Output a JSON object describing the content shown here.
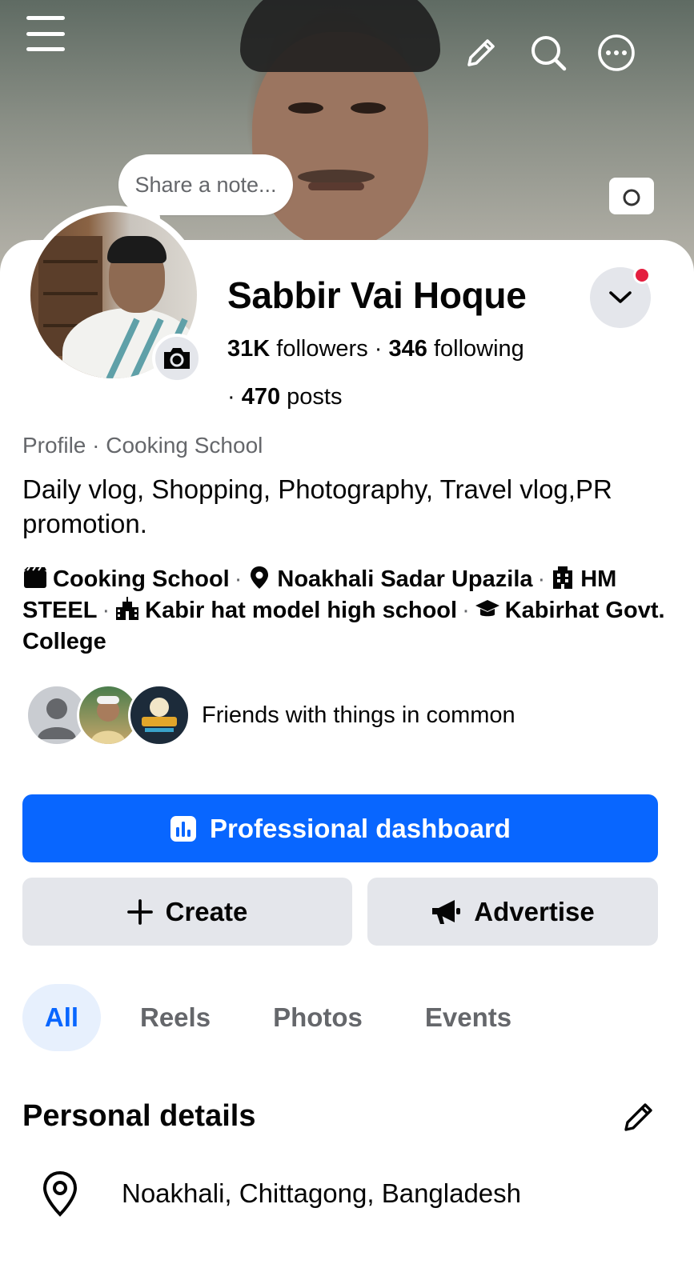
{
  "header": {
    "menu_icon": "hamburger-menu-icon",
    "edit_icon": "pencil-icon",
    "search_icon": "search-icon",
    "more_icon": "more-options-icon",
    "cover_camera_icon": "camera-icon"
  },
  "note": {
    "placeholder": "Share a note..."
  },
  "profile": {
    "name": "Sabbir Vai Hoque",
    "followers_count": "31K",
    "followers_label": "followers",
    "following_count": "346",
    "following_label": "following",
    "posts_count": "470",
    "posts_label": "posts",
    "category": "Profile · Cooking School",
    "bio": "Daily vlog, Shopping, Photography, Travel vlog,PR promotion.",
    "notification_color": "#e41e3f"
  },
  "details_line": [
    {
      "icon": "clapperboard-icon",
      "text": "Cooking School"
    },
    {
      "icon": "location-pin-icon",
      "text": "Noakhali Sadar Upazila"
    },
    {
      "icon": "building-icon",
      "text": "HM STEEL"
    },
    {
      "icon": "school-icon",
      "text": "Kabir hat model high school"
    },
    {
      "icon": "graduation-cap-icon",
      "text": "Kabirhat Govt. College"
    }
  ],
  "friends": {
    "text": "Friends with things in common"
  },
  "actions": {
    "dashboard_label": "Professional dashboard",
    "create_label": "Create",
    "advertise_label": "Advertise",
    "primary_color": "#0866ff"
  },
  "tabs": [
    {
      "label": "All",
      "active": true
    },
    {
      "label": "Reels",
      "active": false
    },
    {
      "label": "Photos",
      "active": false
    },
    {
      "label": "Events",
      "active": false
    }
  ],
  "personal_details": {
    "title": "Personal details",
    "location": "Noakhali, Chittagong, Bangladesh"
  }
}
